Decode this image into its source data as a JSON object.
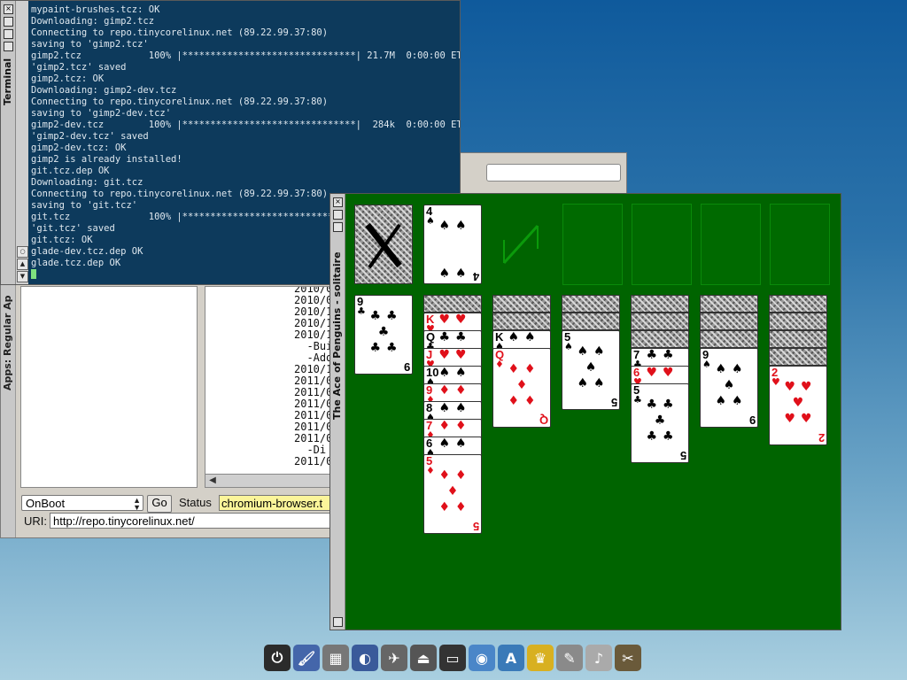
{
  "terminal": {
    "title": "Terminal",
    "lines": [
      "mypaint-brushes.tcz: OK",
      "Downloading: gimp2.tcz",
      "Connecting to repo.tinycorelinux.net (89.22.99.37:80)",
      "saving to 'gimp2.tcz'",
      "gimp2.tcz            100% |*******************************| 21.7M  0:00:00 ETA",
      "'gimp2.tcz' saved",
      "gimp2.tcz: OK",
      "Downloading: gimp2-dev.tcz",
      "Connecting to repo.tinycorelinux.net (89.22.99.37:80)",
      "saving to 'gimp2-dev.tcz'",
      "gimp2-dev.tcz        100% |*******************************|  284k  0:00:00 ETA",
      "'gimp2-dev.tcz' saved",
      "gimp2-dev.tcz: OK",
      "gimp2 is already installed!",
      "git.tcz.dep OK",
      "Downloading: git.tcz",
      "Connecting to repo.tinycorelinux.net (89.22.99.37:80)",
      "saving to 'git.tcz'",
      "git.tcz              100% |***************************",
      "'git.tcz' saved",
      "git.tcz: OK",
      "glade-dev.tcz.dep OK",
      "glade.tcz.dep OK"
    ]
  },
  "apps": {
    "title": "Apps: Regular Ap",
    "info_lines": [
      "2010/0",
      "2010/09",
      "2010/10",
      "2010/11",
      "2010/12",
      "  -Bui",
      "  -Add",
      "2010/12",
      "2011/01",
      "2011/02",
      "2011/02",
      "2011/03",
      "2011/03",
      "2011/05",
      "  -Di",
      "2011/06"
    ],
    "mode_select": "OnBoot",
    "go_label": "Go",
    "status_label": "Status",
    "status_value": "chromium-browser.t",
    "uri_label": "URI:",
    "uri_value": "http://repo.tinycorelinux.net/"
  },
  "solitaire": {
    "title": "The Ace of Penguins - solitaire",
    "waste_card": {
      "rank": "4",
      "suit": "♠",
      "color": "black"
    },
    "tableau": [
      {
        "backs": 0,
        "cards": [
          {
            "rank": "9",
            "suit": "♣",
            "color": "black"
          }
        ]
      },
      {
        "backs": 1,
        "cards": [
          {
            "rank": "K",
            "suit": "♥",
            "color": "red"
          },
          {
            "rank": "Q",
            "suit": "♣",
            "color": "black"
          },
          {
            "rank": "J",
            "suit": "♥",
            "color": "red"
          },
          {
            "rank": "10",
            "suit": "♠",
            "color": "black"
          },
          {
            "rank": "9",
            "suit": "♦",
            "color": "red"
          },
          {
            "rank": "8",
            "suit": "♠",
            "color": "black"
          },
          {
            "rank": "7",
            "suit": "♦",
            "color": "red"
          },
          {
            "rank": "6",
            "suit": "♠",
            "color": "black"
          },
          {
            "rank": "5",
            "suit": "♦",
            "color": "red"
          }
        ]
      },
      {
        "backs": 2,
        "cards": [
          {
            "rank": "K",
            "suit": "♠",
            "color": "black"
          },
          {
            "rank": "Q",
            "suit": "♦",
            "color": "red"
          }
        ]
      },
      {
        "backs": 2,
        "cards": [
          {
            "rank": "5",
            "suit": "♠",
            "color": "black"
          }
        ]
      },
      {
        "backs": 3,
        "cards": [
          {
            "rank": "7",
            "suit": "♣",
            "color": "black"
          },
          {
            "rank": "6",
            "suit": "♥",
            "color": "red"
          },
          {
            "rank": "5",
            "suit": "♣",
            "color": "black"
          }
        ]
      },
      {
        "backs": 3,
        "cards": [
          {
            "rank": "9",
            "suit": "♠",
            "color": "black"
          }
        ]
      },
      {
        "backs": 4,
        "cards": [
          {
            "rank": "2",
            "suit": "♥",
            "color": "red"
          }
        ]
      }
    ],
    "felt_color": "#006400"
  },
  "dock": {
    "icons": [
      {
        "name": "power-icon",
        "glyph": "⏻",
        "color": "#2b2b2b"
      },
      {
        "name": "paintbrush-icon",
        "glyph": "🖌",
        "color": "#4466aa"
      },
      {
        "name": "control-panel-icon",
        "glyph": "▦",
        "color": "#777"
      },
      {
        "name": "apps-icon",
        "glyph": "◐",
        "color": "#3a5a9a"
      },
      {
        "name": "run-icon",
        "glyph": "✈",
        "color": "#666"
      },
      {
        "name": "mount-icon",
        "glyph": "⏏",
        "color": "#555"
      },
      {
        "name": "terminal-icon",
        "glyph": "▭",
        "color": "#333"
      },
      {
        "name": "browser-icon",
        "glyph": "◉",
        "color": "#4a86c8"
      },
      {
        "name": "text-editor-icon",
        "glyph": "A",
        "color": "#3a7ab8"
      },
      {
        "name": "penguin-icon",
        "glyph": "♛",
        "color": "#d8b020"
      },
      {
        "name": "notepad-icon",
        "glyph": "✎",
        "color": "#8a8a8a"
      },
      {
        "name": "document-icon",
        "glyph": "♪",
        "color": "#aaa"
      },
      {
        "name": "gimp-icon",
        "glyph": "✂",
        "color": "#6a5a3a"
      }
    ]
  }
}
